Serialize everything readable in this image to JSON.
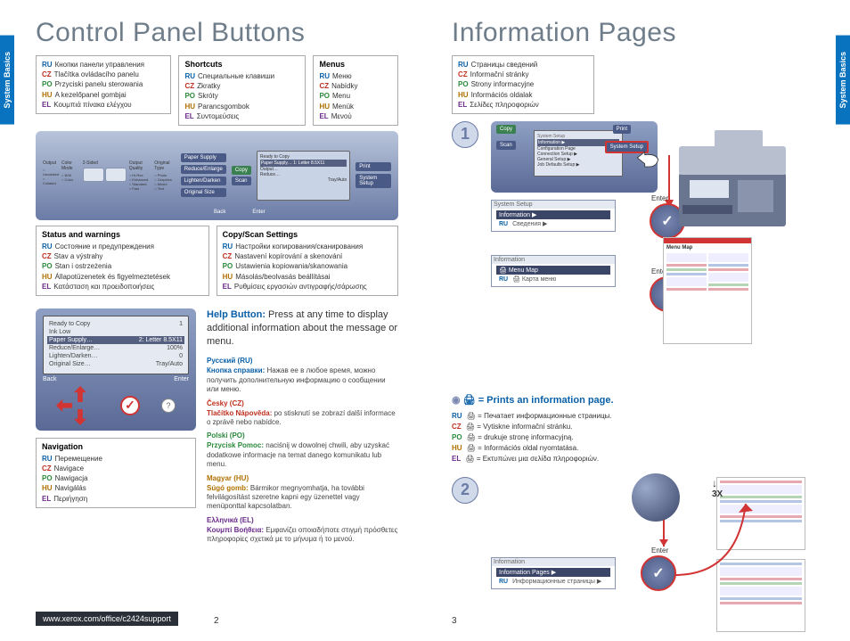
{
  "side_tab": "System Basics",
  "left": {
    "title": "Control Panel Buttons",
    "buttons_block": {
      "rows": [
        {
          "lc": "RU",
          "txt": "Кнопки панели управления"
        },
        {
          "lc": "CZ",
          "txt": "Tlačítka ovládacího panelu"
        },
        {
          "lc": "PO",
          "txt": "Przyciski panelu sterowania"
        },
        {
          "lc": "HU",
          "txt": "A kezelőpanel gombjai"
        },
        {
          "lc": "EL",
          "txt": "Κουμπιά πίνακα ελέγχου"
        }
      ]
    },
    "shortcuts_block": {
      "hdr": "Shortcuts",
      "rows": [
        {
          "lc": "RU",
          "txt": "Специальные клавиши"
        },
        {
          "lc": "CZ",
          "txt": "Zkratky"
        },
        {
          "lc": "PO",
          "txt": "Skróty"
        },
        {
          "lc": "HU",
          "txt": "Parancsgombok"
        },
        {
          "lc": "EL",
          "txt": "Συντομεύσεις"
        }
      ]
    },
    "menus_block": {
      "hdr": "Menus",
      "rows": [
        {
          "lc": "RU",
          "txt": "Меню"
        },
        {
          "lc": "CZ",
          "txt": "Nabídky"
        },
        {
          "lc": "PO",
          "txt": "Menu"
        },
        {
          "lc": "HU",
          "txt": "Menük"
        },
        {
          "lc": "EL",
          "txt": "Μενού"
        }
      ]
    },
    "panel_labels": {
      "output": "Output",
      "color_mode": "Color Mode",
      "two_sided": "2-Sided",
      "output_quality": "Output Quality",
      "original_type": "Original Type",
      "paper_supply": "Paper Supply",
      "copy": "Copy",
      "reduce_enlarge": "Reduce/Enlarge",
      "lighten_darken": "Lighten/Darken",
      "original_size": "Original Size",
      "back": "Back",
      "enter": "Enter",
      "print": "Print",
      "system_setup": "System Setup",
      "scan": "Scan",
      "ready_msg": "Ready to Copy"
    },
    "status_block": {
      "hdr": "Status and warnings",
      "rows": [
        {
          "lc": "RU",
          "txt": "Состояние и предупреждения"
        },
        {
          "lc": "CZ",
          "txt": "Stav a výstrahy"
        },
        {
          "lc": "PO",
          "txt": "Stan i ostrzeżenia"
        },
        {
          "lc": "HU",
          "txt": "Állapotüzenetek és figyelmeztetések"
        },
        {
          "lc": "EL",
          "txt": "Κατάσταση και προειδοποιήσεις"
        }
      ]
    },
    "copyscan_block": {
      "hdr": "Copy/Scan Settings",
      "rows": [
        {
          "lc": "RU",
          "txt": "Настройки копирования/сканирования"
        },
        {
          "lc": "CZ",
          "txt": "Nastavení kopírování a skenování"
        },
        {
          "lc": "PO",
          "txt": "Ustawienia kopiowania/skanowania"
        },
        {
          "lc": "HU",
          "txt": "Másolás/beolvasás beállításai"
        },
        {
          "lc": "EL",
          "txt": "Ρυθμίσεις εργασιών αντιγραφής/σάρωσης"
        }
      ]
    },
    "lcd": {
      "l1a": "Ready to Copy",
      "l1b": "1",
      "l2": "Ink Low",
      "l3a": "Paper Supply…",
      "l3b": "2: Letter 8.5X11",
      "l4a": "Reduce/Enlarge…",
      "l4b": "100%",
      "l5a": "Lighten/Darken…",
      "l5b": "0",
      "l6a": "Original Size…",
      "l6b": "Tray/Auto",
      "back": "Back",
      "enter": "Enter"
    },
    "nav_block": {
      "hdr": "Navigation",
      "rows": [
        {
          "lc": "RU",
          "txt": "Перемещение"
        },
        {
          "lc": "CZ",
          "txt": "Navigace"
        },
        {
          "lc": "PO",
          "txt": "Nawigacja"
        },
        {
          "lc": "HU",
          "txt": "Navigálás"
        },
        {
          "lc": "EL",
          "txt": "Περιήγηση"
        }
      ]
    },
    "help": {
      "lead_bold": "Help Button:",
      "lead": " Press at any time to display additional information about the message or menu.",
      "ru_head": "Русский (RU)",
      "ru_body_b": "Кнопка справки:",
      "ru_body": " Нажав ее в любое время, можно получить дополнительную информацию о сообщении или меню.",
      "cz_head": "Česky (CZ)",
      "cz_body_b": "Tlačítko Nápověda:",
      "cz_body": " po stisknutí se zobrazí další informace o zprávě nebo nabídce.",
      "po_head": "Polski (PO)",
      "po_body_b": "Przycisk Pomoc:",
      "po_body": " naciśnij w dowolnej chwili, aby uzyskać dodatkowe informacje na temat danego komunikatu lub menu.",
      "hu_head": "Magyar (HU)",
      "hu_body_b": "Súgó gomb:",
      "hu_body": " Bármikor megnyomhatja, ha további felvilágosítást szeretne kapni egy üzenettel vagy menüponttal kapcsolatban.",
      "el_head": "Ελληνικά (EL)",
      "el_body_b": "Κουμπί Βοήθεια:",
      "el_body": " Εμφανίζει οποιαδήποτε στιγμή πρόσθετες πληροφορίες σχετικά με το μήνυμα ή το μενού."
    },
    "url": "www.xerox.com/office/c2424support",
    "page_num": "2"
  },
  "right": {
    "title": "Information Pages",
    "pages_block": {
      "rows": [
        {
          "lc": "RU",
          "txt": "Страницы сведений"
        },
        {
          "lc": "CZ",
          "txt": "Informační stránky"
        },
        {
          "lc": "PO",
          "txt": "Strony informacyjne"
        },
        {
          "lc": "HU",
          "txt": "Információs oldalak"
        },
        {
          "lc": "EL",
          "txt": "Σελίδες πληροφοριών"
        }
      ]
    },
    "step1": "1",
    "step2": "2",
    "menu_btns": {
      "copy": "Copy",
      "scan": "Scan",
      "print": "Print",
      "system_setup": "System Setup"
    },
    "menu_lcd": {
      "l1": "System Setup",
      "l2": "Information ▶",
      "l3": "Configuration Page",
      "l4": "Connection Setup ▶",
      "l5": "General Setup ▶",
      "l6": "Job Defaults Setup ▶"
    },
    "enter": "Enter",
    "flow1": {
      "bh": "System Setup",
      "sel": "Information ▶",
      "plain_lc": "RU",
      "plain": "Сведения ▶"
    },
    "flow2": {
      "bh": "Information",
      "sel": "🖨 Menu Map",
      "plain_lc": "RU",
      "plain": "🖨 Карта меню"
    },
    "flow3": {
      "bh": "Information",
      "sel": "Information Pages ▶",
      "plain_lc": "RU",
      "plain": "Информационные страницы ▶"
    },
    "prints_line": "= Prints an information page.",
    "prints_rows": [
      {
        "lc": "RU",
        "txt": "🖨 = Печатает информационные страницы."
      },
      {
        "lc": "CZ",
        "txt": "🖨 = Vytiskne informační stránku."
      },
      {
        "lc": "PO",
        "txt": "🖨 = drukuje stronę informacyjną."
      },
      {
        "lc": "HU",
        "txt": "🖨 = Információs oldal nyomtatása."
      },
      {
        "lc": "EL",
        "txt": "🖨 = Eκτυπώνει μια σελίδα πληροφοριών."
      }
    ],
    "x3": "3X",
    "page_num": "3",
    "doc_title": "Menu Map"
  }
}
